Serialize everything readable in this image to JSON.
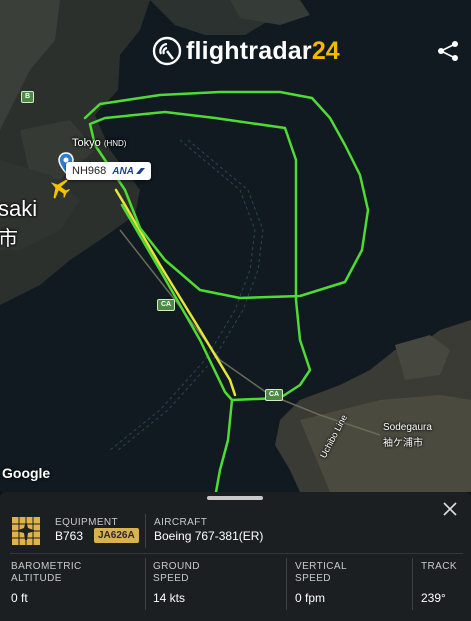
{
  "app": {
    "logo_text": "flightradar",
    "logo_accent": "24",
    "share_icon": "share-icon"
  },
  "map": {
    "airport_name": "Tokyo",
    "airport_code": "(HND)",
    "flight_callsign": "NH968",
    "airline_logo": "ANA",
    "places": {
      "kawasaki": "saki",
      "kawasaki_jp": "市",
      "sodegaura": "Sodegaura",
      "sodegaura_jp": "袖ケ浦市",
      "uchibo": "Uchibo Line"
    },
    "road_shields": {
      "ca1": "CA",
      "ca2": "CA",
      "b": "B"
    },
    "attribution": "Google",
    "colors": {
      "track_green": "#4fdb34",
      "track_yellow": "#e7e53a",
      "water": "#0f1a1f",
      "land": "#2a2f2b"
    }
  },
  "panel": {
    "equipment_label": "EQUIPMENT",
    "equipment_value": "B763",
    "registration": "JA626A",
    "aircraft_label": "AIRCRAFT",
    "aircraft_value": "Boeing 767-381(ER)",
    "baro_label_1": "BAROMETRIC",
    "baro_label_2": "ALTITUDE",
    "baro_value": "0 ft",
    "gs_label_1": "GROUND",
    "gs_label_2": "SPEED",
    "gs_value": "14 kts",
    "vs_label_1": "VERTICAL",
    "vs_label_2": "SPEED",
    "vs_value": "0 fpm",
    "track_label": "TRACK",
    "track_value": "239°"
  }
}
